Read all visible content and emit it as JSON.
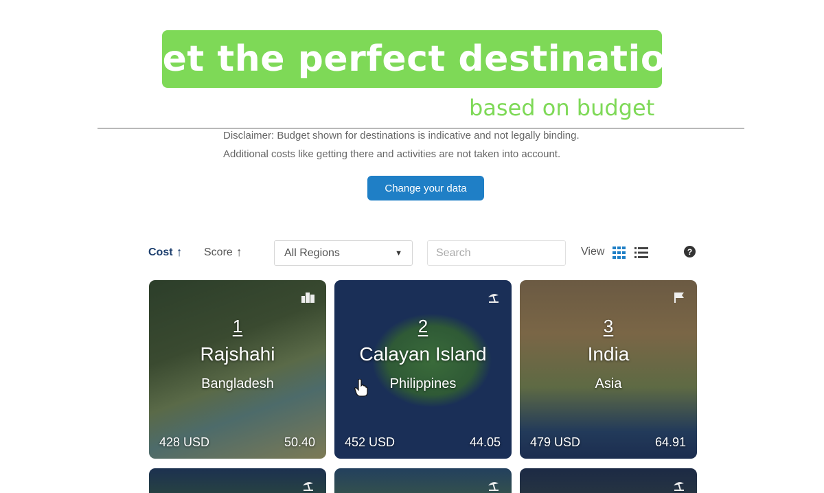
{
  "hero": {
    "title": "Get the perfect destination",
    "subtitle": "based on budget"
  },
  "disclaimer": {
    "line1": "Disclaimer: Budget shown for destinations is indicative and not legally binding.",
    "line2": "Additional costs like getting there and activities are not taken into account."
  },
  "change_button": "Change your data",
  "toolbar": {
    "sort_cost": "Cost",
    "sort_score": "Score",
    "region_selected": "All Regions",
    "search_placeholder": "Search",
    "view_label": "View"
  },
  "colors": {
    "hero_green": "#7ed957",
    "button_blue": "#1f7fc6",
    "active_sort": "#1d3f6e"
  },
  "cards": [
    {
      "rank": "1",
      "name": "Rajshahi",
      "region": "Bangladesh",
      "cost": "428 USD",
      "score": "50.40",
      "icon": "city-icon"
    },
    {
      "rank": "2",
      "name": "Calayan Island",
      "region": "Philippines",
      "cost": "452 USD",
      "score": "44.05",
      "icon": "beach-umbrella-icon"
    },
    {
      "rank": "3",
      "name": "India",
      "region": "Asia",
      "cost": "479 USD",
      "score": "64.91",
      "icon": "flag-icon"
    },
    {
      "icon": "beach-umbrella-icon"
    },
    {
      "icon": "beach-umbrella-icon"
    },
    {
      "icon": "beach-umbrella-icon"
    }
  ]
}
